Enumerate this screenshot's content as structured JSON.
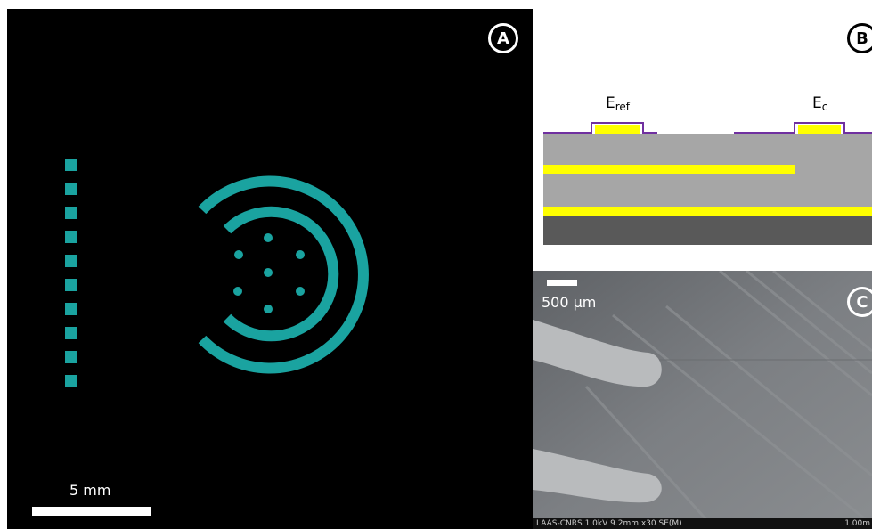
{
  "panels": {
    "a": {
      "label": "A",
      "scale_bar": "5 mm",
      "colors": {
        "background": "#000000",
        "pattern": "#1aa3a0",
        "scale": "#ffffff"
      },
      "pad_count": 10,
      "inner_dot_count": 7
    },
    "b": {
      "label": "B",
      "electrodes": [
        {
          "base": "E",
          "sub": "ref"
        },
        {
          "base": "E",
          "sub": "c"
        }
      ],
      "colors": {
        "substrate_light": "#a6a6a6",
        "substrate_dark": "#595959",
        "metal": "#ffff00",
        "passivation": "#7030a0"
      }
    },
    "c": {
      "label": "C",
      "scale_bar": "500 µm",
      "sem_info": "LAAS-CNRS 1.0kV 9.2mm x30 SE(M)",
      "sem_length": "1.00m"
    }
  }
}
